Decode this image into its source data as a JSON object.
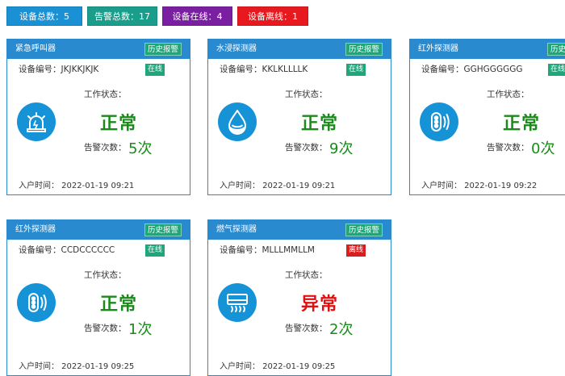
{
  "summary": {
    "total": {
      "label": "设备总数：5",
      "color": "#1a90d5"
    },
    "alarm_total": {
      "label": "告警总数：17",
      "color": "#1a9e8b"
    },
    "online": {
      "label": "设备在线：4",
      "color": "#7b1fa2"
    },
    "offline": {
      "label": "设备离线：1",
      "color": "#e8191e"
    }
  },
  "labels": {
    "history_button": "历史报警",
    "work_status": "工作状态：",
    "alarm_count": "告警次数：",
    "device_id_prefix": "设备编号：",
    "install_time_prefix": "入户时间："
  },
  "colors": {
    "header": "#2a8ad0",
    "online_tag": "#1fa67a",
    "offline_tag": "#d81e1e",
    "normal_text": "#1a8a1a",
    "abnormal_text": "#e01010",
    "icon_bg": "#1693d6"
  },
  "devices": [
    {
      "title": "紧急呼叫器",
      "device_id": "设备编号：JKJKKJKJK",
      "status_tag": "在线",
      "online": true,
      "work_state": "正常",
      "alarm_times": "5次",
      "install_time": "入户时间：   2022-01-19 09:21",
      "icon": "alarm-siren-icon"
    },
    {
      "title": "水浸探测器",
      "device_id": "设备编号：KKLKLLLLK",
      "status_tag": "在线",
      "online": true,
      "work_state": "正常",
      "alarm_times": "9次",
      "install_time": "入户时间：   2022-01-19 09:21",
      "icon": "water-drop-icon"
    },
    {
      "title": "红外探测器",
      "device_id": "设备编号：GGHGGGGGG",
      "status_tag": "在线",
      "online": true,
      "work_state": "正常",
      "alarm_times": "0次",
      "install_time": "入户时间：   2022-01-19 09:22",
      "icon": "infrared-sensor-icon"
    },
    {
      "title": "红外探测器",
      "device_id": "设备编号：CCDCCCCCC",
      "status_tag": "在线",
      "online": true,
      "work_state": "正常",
      "alarm_times": "1次",
      "install_time": "入户时间：   2022-01-19 09:25",
      "icon": "infrared-sensor-icon"
    },
    {
      "title": "燃气探测器",
      "device_id": "设备编号：MLLLMMLLM",
      "status_tag": "离线",
      "online": false,
      "work_state": "异常",
      "alarm_times": "2次",
      "install_time": "入户时间：   2022-01-19 09:25",
      "icon": "gas-detector-icon"
    }
  ]
}
